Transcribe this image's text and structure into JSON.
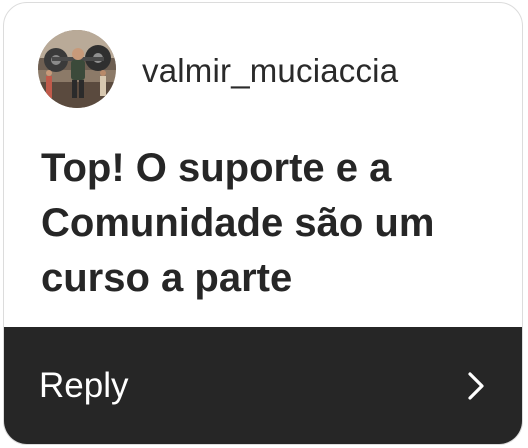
{
  "comment": {
    "username": "valmir_muciaccia",
    "text": "Top! O suporte e a Comunidade são um curso a parte"
  },
  "reply": {
    "label": "Reply",
    "icon": "chevron-right-icon"
  },
  "colors": {
    "reply_bar_bg": "#262626",
    "text_primary": "#262626",
    "border": "#dcdcdc"
  }
}
